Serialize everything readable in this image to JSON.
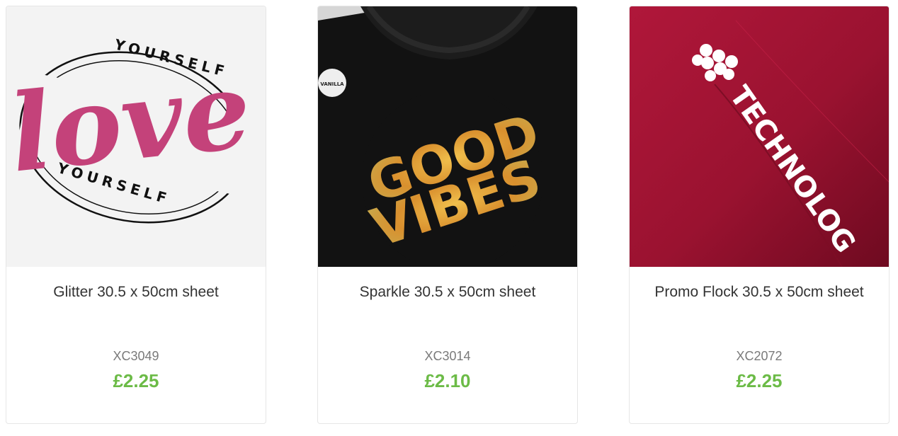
{
  "products": [
    {
      "title": "Glitter 30.5 x 50cm sheet",
      "sku": "XC3049",
      "price": "£2.25",
      "image": {
        "background": "#f4f4f4",
        "art_main": "love",
        "art_ring_top": "YOURSELF",
        "art_ring_bottom": "YOURSELF",
        "art_color": "#c4427a"
      }
    },
    {
      "title": "Sparkle 30.5 x 50cm sheet",
      "sku": "XC3014",
      "price": "£2.10",
      "image": {
        "background": "#111111",
        "art_line1": "GOOD",
        "art_line2": "VIBES",
        "art_color": "#d9a03a",
        "tag_text": "VANILLA"
      }
    },
    {
      "title": "Promo Flock 30.5 x 50cm sheet",
      "sku": "XC2072",
      "price": "£2.25",
      "image": {
        "background": "#9e1430",
        "art_text": "TECHNOLOG",
        "art_color": "#ffffff"
      }
    }
  ],
  "colors": {
    "price": "#6cbb47",
    "title": "#333333",
    "sku": "#7a7a7a",
    "border": "#e6e6e6"
  }
}
